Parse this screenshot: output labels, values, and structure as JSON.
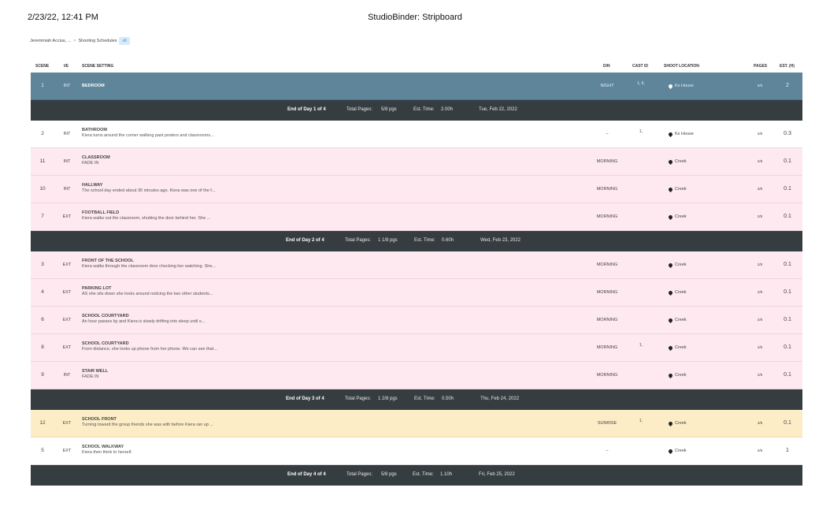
{
  "print_header": {
    "datetime": "2/23/22, 12:41 PM",
    "title": "StudioBinder: Stripboard"
  },
  "breadcrumb": {
    "project": "Jeremmiah Accius, ...",
    "separator": ">",
    "section": "Shooting Schedules",
    "badge": "v6"
  },
  "columns": {
    "scene": "SCENE",
    "ie": "I/E",
    "setting": "SCENE SETTING",
    "dn": "D/N",
    "cast": "CAST ID",
    "location": "SHOOT LOCATION",
    "pages": "PAGES",
    "est": "EST. (H)"
  },
  "rows": [
    {
      "scene": "1",
      "ie": "INT",
      "setting": "BEDROOM",
      "desc": "",
      "dn": "NIGHT",
      "cast": "1,  6,",
      "location": "Ks House",
      "pages": "5/8",
      "est": "2"
    },
    {
      "end": "End of Day 1 of 4",
      "total_pages_label": "Total Pages:",
      "total_pages": "5/8 pgs",
      "est_label": "Est. Time:",
      "est_time": "2.00h",
      "date": "Tue, Feb 22, 2022"
    },
    {
      "scene": "2",
      "ie": "INT",
      "setting": "BATHROOM",
      "desc": "Kiera turns around the corner walking past posters and classrooms...",
      "dn": "–",
      "cast": "1,",
      "location": "Ks House",
      "pages": "2/8",
      "est": "0.3"
    },
    {
      "scene": "11",
      "ie": "INT",
      "setting": "CLASSROOM",
      "desc": "FADE IN",
      "dn": "MORNING",
      "cast": "",
      "location": "Creek",
      "pages": "2/8",
      "est": "0.1"
    },
    {
      "scene": "10",
      "ie": "INT",
      "setting": "HALLWAY",
      "desc": "The school day ended about 30 minutes ago. Kiera was one of the f...",
      "dn": "MORNING",
      "cast": "",
      "location": "Creek",
      "pages": "3/8",
      "est": "0.1"
    },
    {
      "scene": "7",
      "ie": "EXT",
      "setting": "FOOTBALL FIELD",
      "desc": "Kiera walks out the classroom, shutting the door behind her. She ...",
      "dn": "MORNING",
      "cast": "",
      "location": "Creek",
      "pages": "2/8",
      "est": "0.1"
    },
    {
      "end": "End of Day 2 of 4",
      "total_pages_label": "Total Pages:",
      "total_pages": "1 1/8 pgs",
      "est_label": "Est. Time:",
      "est_time": "0.60h",
      "date": "Wed, Feb 23, 2022"
    },
    {
      "scene": "3",
      "ie": "EXT",
      "setting": "FRONT OF THE SCHOOL",
      "desc": "Kiera walks through the classroom door checking her watching. She...",
      "dn": "MORNING",
      "cast": "",
      "location": "Creek",
      "pages": "2/8",
      "est": "0.1"
    },
    {
      "scene": "4",
      "ie": "EXT",
      "setting": "PARKING LOT",
      "desc": "AS she sits down she looks around noticing the two other students...",
      "dn": "MORNING",
      "cast": "",
      "location": "Creek",
      "pages": "2/8",
      "est": "0.1"
    },
    {
      "scene": "6",
      "ie": "EXT",
      "setting": "SCHOOL COURTYARD",
      "desc": "An hour passes by and Kiera is slowly drifting into sleep until s...",
      "dn": "MORNING",
      "cast": "",
      "location": "Creek",
      "pages": "2/8",
      "est": "0.1"
    },
    {
      "scene": "8",
      "ie": "EXT",
      "setting": "SCHOOL COURTYARD",
      "desc": "From distance, she looks up phone from her phone. We can see that...",
      "dn": "MORNING",
      "cast": "1,",
      "location": "Creek",
      "pages": "2/8",
      "est": "0.1"
    },
    {
      "scene": "9",
      "ie": "INT",
      "setting": "STAIR WELL",
      "desc": "FADE IN",
      "dn": "MORNING",
      "cast": "",
      "location": "Creek",
      "pages": "2/8",
      "est": "0.1"
    },
    {
      "end": "End of Day 3 of 4",
      "total_pages_label": "Total Pages:",
      "total_pages": "1 2/8 pgs",
      "est_label": "Est. Time:",
      "est_time": "0.50h",
      "date": "Thu, Feb 24, 2022"
    },
    {
      "scene": "12",
      "ie": "EXT",
      "setting": "SCHOOL FRONT",
      "desc": "Turning toward the group friends she was with before Kiera ran up ...",
      "dn": "SUNRISE",
      "cast": "1,",
      "location": "Creek",
      "pages": "3/8",
      "est": "0.1"
    },
    {
      "scene": "5",
      "ie": "EXT",
      "setting": "SCHOOL WALKWAY",
      "desc": "Kiera then think to herself.",
      "dn": "–",
      "cast": "",
      "location": "Creek",
      "pages": "2/8",
      "est": "1"
    },
    {
      "end": "End of Day 4 of 4",
      "total_pages_label": "Total Pages:",
      "total_pages": "5/8 pgs",
      "est_label": "Est. Time:",
      "est_time": "1.10h",
      "date": "Fri, Feb 25, 2022"
    }
  ],
  "colors": {
    "night_strip": "#5e8599",
    "morning_strip": "#fde9ef",
    "sunrise_strip": "#fdedc7",
    "day_break": "#363d41",
    "version_badge": "#d6ebfa"
  },
  "icons": {
    "location": "map-pin-icon"
  }
}
